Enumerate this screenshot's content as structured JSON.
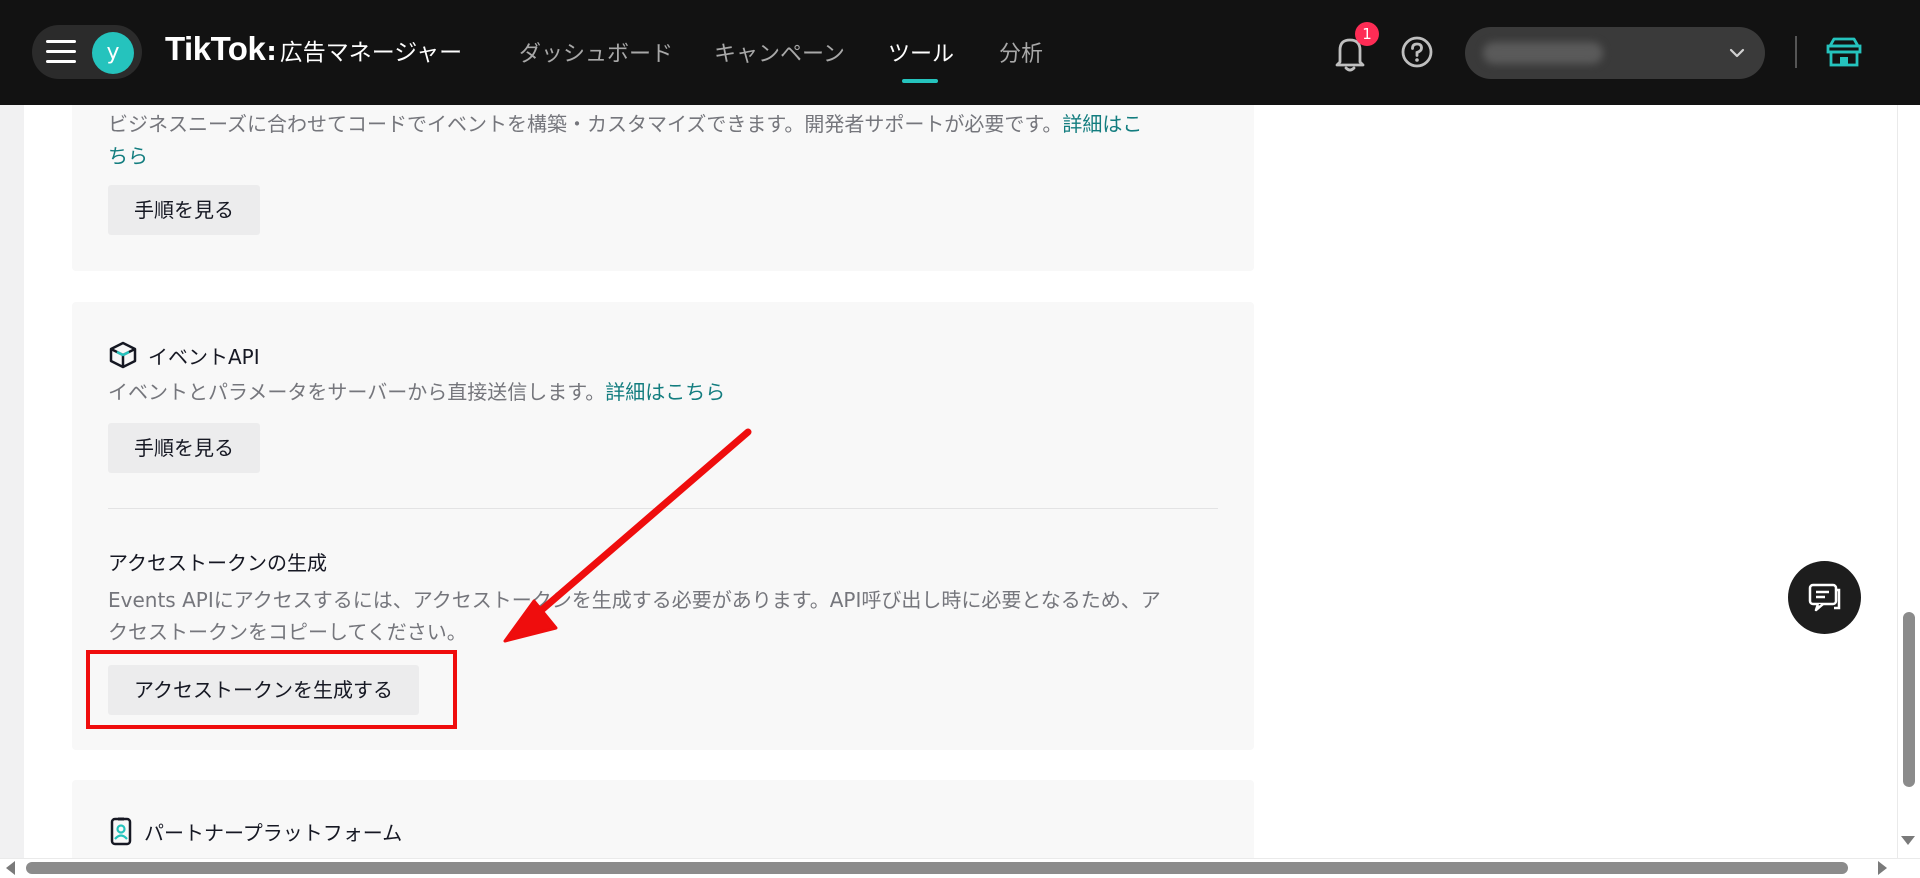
{
  "header": {
    "brand": "TikTok",
    "brand_sep": ":",
    "product": "広告マネージャー",
    "avatar_initial": "y",
    "nav": [
      {
        "label": "ダッシュボード",
        "active": false
      },
      {
        "label": "キャンペーン",
        "active": false
      },
      {
        "label": "ツール",
        "active": true
      },
      {
        "label": "分析",
        "active": false
      }
    ],
    "notification_count": "1",
    "icons": {
      "menu": "hamburger-icon",
      "notifications": "bell-icon",
      "help": "help-icon",
      "account_caret": "chevron-down-icon",
      "shop": "shop-icon"
    }
  },
  "custom_code": {
    "description": "ビジネスニーズに合わせてコードでイベントを構築・カスタマイズできます。開発者サポートが必要です。",
    "link_part1": "詳細はこ",
    "link_part2": "ちら",
    "button": "手順を見る"
  },
  "events_api": {
    "title": "イベントAPI",
    "icon": "cube-icon",
    "description": "イベントとパラメータをサーバーから直接送信します。",
    "link": "詳細はこちら",
    "button": "手順を見る",
    "token": {
      "title": "アクセストークンの生成",
      "description_line1": "Events APIにアクセスするには、アクセストークンを生成する必要があります。API呼び出し時に必要となるため、ア",
      "description_line2": "クセストークンをコピーしてください。",
      "button": "アクセストークンを生成する"
    }
  },
  "partner": {
    "title": "パートナープラットフォーム",
    "icon": "partner-icon"
  },
  "colors": {
    "accent": "#25c3bd",
    "link": "#137d7f",
    "annotation_red": "#ef0d0d",
    "badge": "#fe2c55"
  }
}
